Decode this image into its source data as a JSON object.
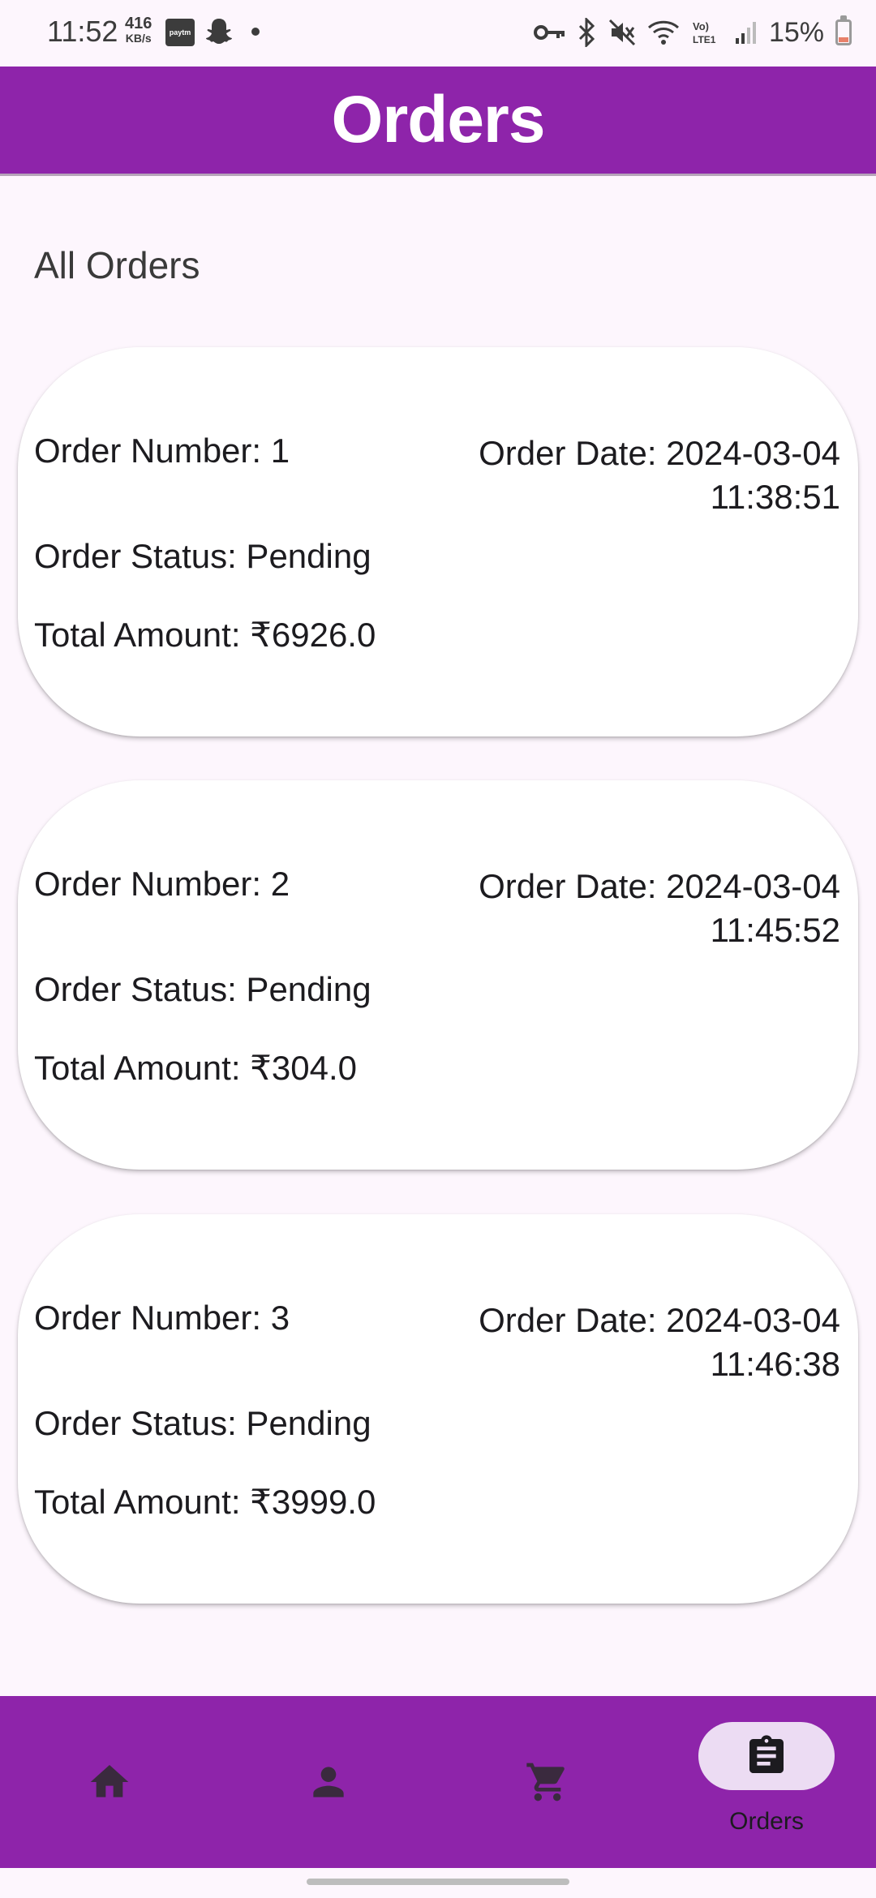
{
  "status_bar": {
    "time": "11:52",
    "net_speed_value": "416",
    "net_speed_unit": "KB/s",
    "paytm_label": "paytm",
    "battery": "15%"
  },
  "header": {
    "title": "Orders"
  },
  "section_title": "All Orders",
  "orders": [
    {
      "number": "Order Number: 1",
      "date": "Order Date: 2024-03-04",
      "time": "11:38:51",
      "status": "Order Status: Pending",
      "amount": "Total Amount: ₹6926.0"
    },
    {
      "number": "Order Number: 2",
      "date": "Order Date: 2024-03-04",
      "time": "11:45:52",
      "status": "Order Status: Pending",
      "amount": "Total Amount: ₹304.0"
    },
    {
      "number": "Order Number: 3",
      "date": "Order Date: 2024-03-04",
      "time": "11:46:38",
      "status": "Order Status: Pending",
      "amount": "Total Amount: ₹3999.0"
    }
  ],
  "bottom_nav": {
    "items": [
      {
        "icon": "home-icon",
        "label": ""
      },
      {
        "icon": "person-icon",
        "label": ""
      },
      {
        "icon": "cart-icon",
        "label": ""
      },
      {
        "icon": "clipboard-icon",
        "label": "Orders",
        "active": true
      }
    ]
  },
  "colors": {
    "primary": "#8e24aa",
    "background": "#fdf6fd",
    "card": "#ffffff",
    "active_pill": "#ecdcf3"
  }
}
